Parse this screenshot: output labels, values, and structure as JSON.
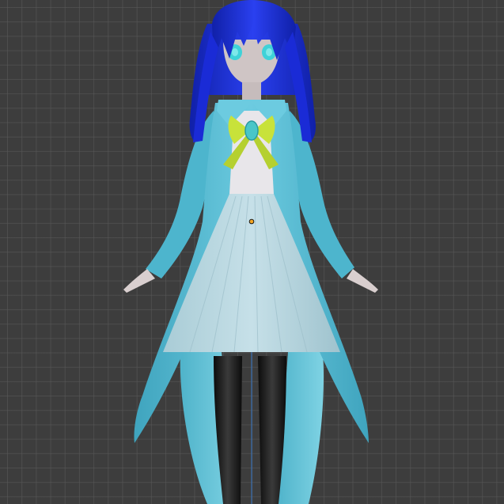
{
  "viewport": {
    "grid_color": "#5a5a5a",
    "background_color": "#3d3d3d"
  },
  "model": {
    "hair_color": "#1a2bd6",
    "eye_color": "#3fd2d8",
    "skin_color": "#d9cfcf",
    "coat_color": "#5cc1d8",
    "skirt_color": "#b9d9e2",
    "shirt_color": "#e8e6ea",
    "bow_color": "#c8e23a",
    "brooch_color": "#49c6c8",
    "stocking_color": "#1c1c1c",
    "origin_point_color": "#f5a623"
  },
  "axes": {
    "z_axis_color": "#3a6fb0"
  }
}
